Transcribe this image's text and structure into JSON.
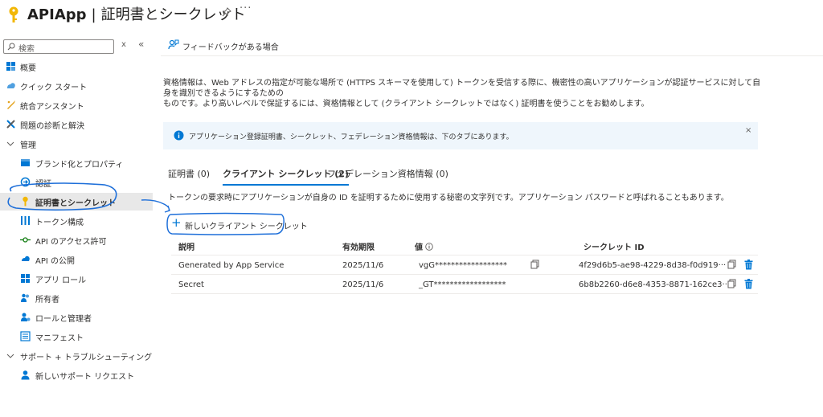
{
  "header": {
    "app_name": "APIApp",
    "separator": "|",
    "page_title": "証明書とシークレット",
    "more": "···"
  },
  "sidebar": {
    "search_placeholder": "検索",
    "clear": "x",
    "collapse": "«",
    "items": [
      {
        "label": "概要",
        "icon": "overview-icon"
      },
      {
        "label": "クイック スタート",
        "icon": "quickstart-icon"
      },
      {
        "label": "統合アシスタント",
        "icon": "integration-assistant-icon"
      },
      {
        "label": "問題の診断と解決",
        "icon": "diagnose-icon"
      },
      {
        "label": "管理",
        "icon": "chevron-down-icon"
      },
      {
        "label": "ブランド化とプロパティ",
        "icon": "branding-icon"
      },
      {
        "label": "認証",
        "icon": "authentication-icon"
      },
      {
        "label": "証明書とシークレット",
        "icon": "key-icon"
      },
      {
        "label": "トークン構成",
        "icon": "token-config-icon"
      },
      {
        "label": "API のアクセス許可",
        "icon": "api-permissions-icon"
      },
      {
        "label": "API の公開",
        "icon": "expose-api-icon"
      },
      {
        "label": "アプリ ロール",
        "icon": "app-roles-icon"
      },
      {
        "label": "所有者",
        "icon": "owners-icon"
      },
      {
        "label": "ロールと管理者",
        "icon": "roles-admins-icon"
      },
      {
        "label": "マニフェスト",
        "icon": "manifest-icon"
      },
      {
        "label": "サポート + トラブルシューティング",
        "icon": "chevron-down-icon"
      },
      {
        "label": "新しいサポート リクエスト",
        "icon": "support-request-icon"
      }
    ]
  },
  "commandbar": {
    "feedback_label": "フィードバックがある場合"
  },
  "main": {
    "description_1": "資格情報は、Web アドレスの指定が可能な場所で (HTTPS スキーマを使用して) トークンを受信する際に、機密性の高いアプリケーションが認証サービスに対して自身を識別できるようにするための",
    "description_2": "ものです。より高いレベルで保証するには、資格情報として (クライアント シークレットではなく) 証明書を使うことをお勧めします。",
    "info_text": "アプリケーション登録証明書、シークレット、フェデレーション資格情報は、下のタブにあります。",
    "info_close": "×",
    "tabs": [
      {
        "label": "証明書 (0)"
      },
      {
        "label": "クライアント シークレット (2)"
      },
      {
        "label": "フェデレーション資格情報 (0)"
      }
    ],
    "tab_description": "トークンの要求時にアプリケーションが自身の ID を証明するために使用する秘密の文字列です。アプリケーション パスワードと呼ばれることもあります。",
    "new_secret_plus": "+",
    "new_secret_label": "新しいクライアント シークレット"
  },
  "table": {
    "columns": [
      "説明",
      "有効期限",
      "値",
      "シークレット ID"
    ],
    "rows": [
      {
        "description": "Generated by App Service",
        "expires": "2025/11/6",
        "value": "vgG******************",
        "secret_id": "4f29d6b5-ae98-4229-8d38-f0d919···"
      },
      {
        "description": "Secret",
        "expires": "2025/11/6",
        "value": "_GT******************",
        "secret_id": "6b8b2260-d6e8-4353-8871-162ce3···"
      }
    ]
  },
  "colors": {
    "accent": "#0078d4",
    "annotation": "#1e6fd9",
    "info_bg": "#eff6fc",
    "active_nav_bg": "#e8e8e8",
    "key_yellow": "#f2b705"
  }
}
